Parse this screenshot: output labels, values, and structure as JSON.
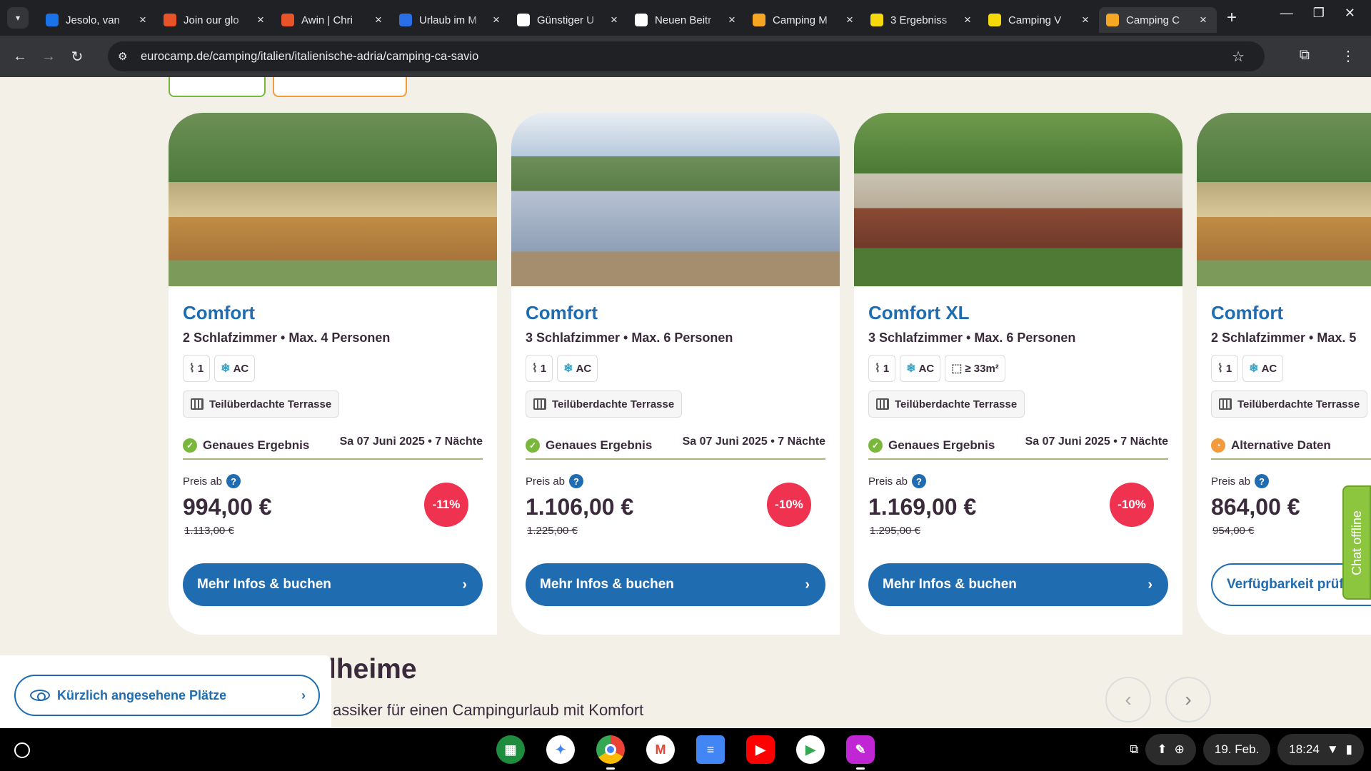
{
  "browser": {
    "tabs": [
      {
        "title": "Jesolo, van",
        "icon_color": "#1a73e8",
        "icon": "wing-icon"
      },
      {
        "title": "Join our glo",
        "icon_color": "#e8542a",
        "icon": "flame-icon"
      },
      {
        "title": "Awin | Chri",
        "icon_color": "#e8542a",
        "icon": "flame-icon"
      },
      {
        "title": "Urlaub im M",
        "icon_color": "#2a6ee8",
        "icon": "c-icon"
      },
      {
        "title": "Günstiger U",
        "icon_color": "#ffffff",
        "icon": "openai-icon"
      },
      {
        "title": "Neuen Beitr",
        "icon_color": "#ffffff",
        "icon": "doc-icon"
      },
      {
        "title": "Camping M",
        "icon_color": "#f5a623",
        "icon": "eurocamp-icon"
      },
      {
        "title": "3 Ergebniss",
        "icon_color": "#f5d90a",
        "icon": "lidl-icon"
      },
      {
        "title": "Camping V",
        "icon_color": "#f5d90a",
        "icon": "lidl-icon"
      },
      {
        "title": "Camping C",
        "icon_color": "#f5a623",
        "icon": "eurocamp-icon",
        "active": true
      }
    ],
    "url": "eurocamp.de/camping/italien/italienische-adria/camping-ca-savio"
  },
  "cards": [
    {
      "title": "Comfort",
      "subtitle": "2 Schlafzimmer • Max. 4 Personen",
      "badges": [
        "1",
        "AC"
      ],
      "feature": "Teilüberdachte Terrasse",
      "status": "Genaues Ergebnis",
      "status_type": "exact",
      "date": "Sa 07 Juni 2025 • 7 Nächte",
      "price_label": "Preis ab",
      "price": "994,00 €",
      "old_price": "1.113,00 €",
      "discount": "-11%",
      "cta": "Mehr Infos & buchen"
    },
    {
      "title": "Comfort",
      "subtitle": "3 Schlafzimmer • Max. 6 Personen",
      "badges": [
        "1",
        "AC"
      ],
      "feature": "Teilüberdachte Terrasse",
      "status": "Genaues Ergebnis",
      "status_type": "exact",
      "date": "Sa 07 Juni 2025 • 7 Nächte",
      "price_label": "Preis ab",
      "price": "1.106,00 €",
      "old_price": "1.225,00 €",
      "discount": "-10%",
      "cta": "Mehr Infos & buchen"
    },
    {
      "title": "Comfort XL",
      "subtitle": "3 Schlafzimmer • Max. 6 Personen",
      "badges": [
        "1",
        "AC",
        "≥ 33m²"
      ],
      "feature": "Teilüberdachte Terrasse",
      "status": "Genaues Ergebnis",
      "status_type": "exact",
      "date": "Sa 07 Juni 2025 • 7 Nächte",
      "price_label": "Preis ab",
      "price": "1.169,00 €",
      "old_price": "1.295,00 €",
      "discount": "-10%",
      "cta": "Mehr Infos & buchen"
    },
    {
      "title": "Comfort",
      "subtitle": "2 Schlafzimmer • Max. 5",
      "badges": [
        "1",
        "AC"
      ],
      "feature": "Teilüberdachte Terrasse",
      "status": "Alternative Daten",
      "status_type": "alternative",
      "date": "",
      "price_label": "Preis ab",
      "price": "864,00 €",
      "old_price": "954,00 €",
      "discount": "",
      "cta": "Verfügbarkeit prüf"
    }
  ],
  "section": {
    "title": "lheime",
    "subtitle": "assiker für einen Campingurlaub mit Komfort"
  },
  "recent": {
    "label": "Kürzlich angesehene Plätze"
  },
  "chat": {
    "label": "Chat offline"
  },
  "shelf": {
    "date": "19. Feb.",
    "time": "18:24"
  },
  "colors": {
    "brand_blue": "#1f6db0",
    "discount_red": "#ef3250",
    "ok_green": "#7ab83c",
    "alt_orange": "#f39a3a",
    "chat_green": "#8cc63f"
  }
}
